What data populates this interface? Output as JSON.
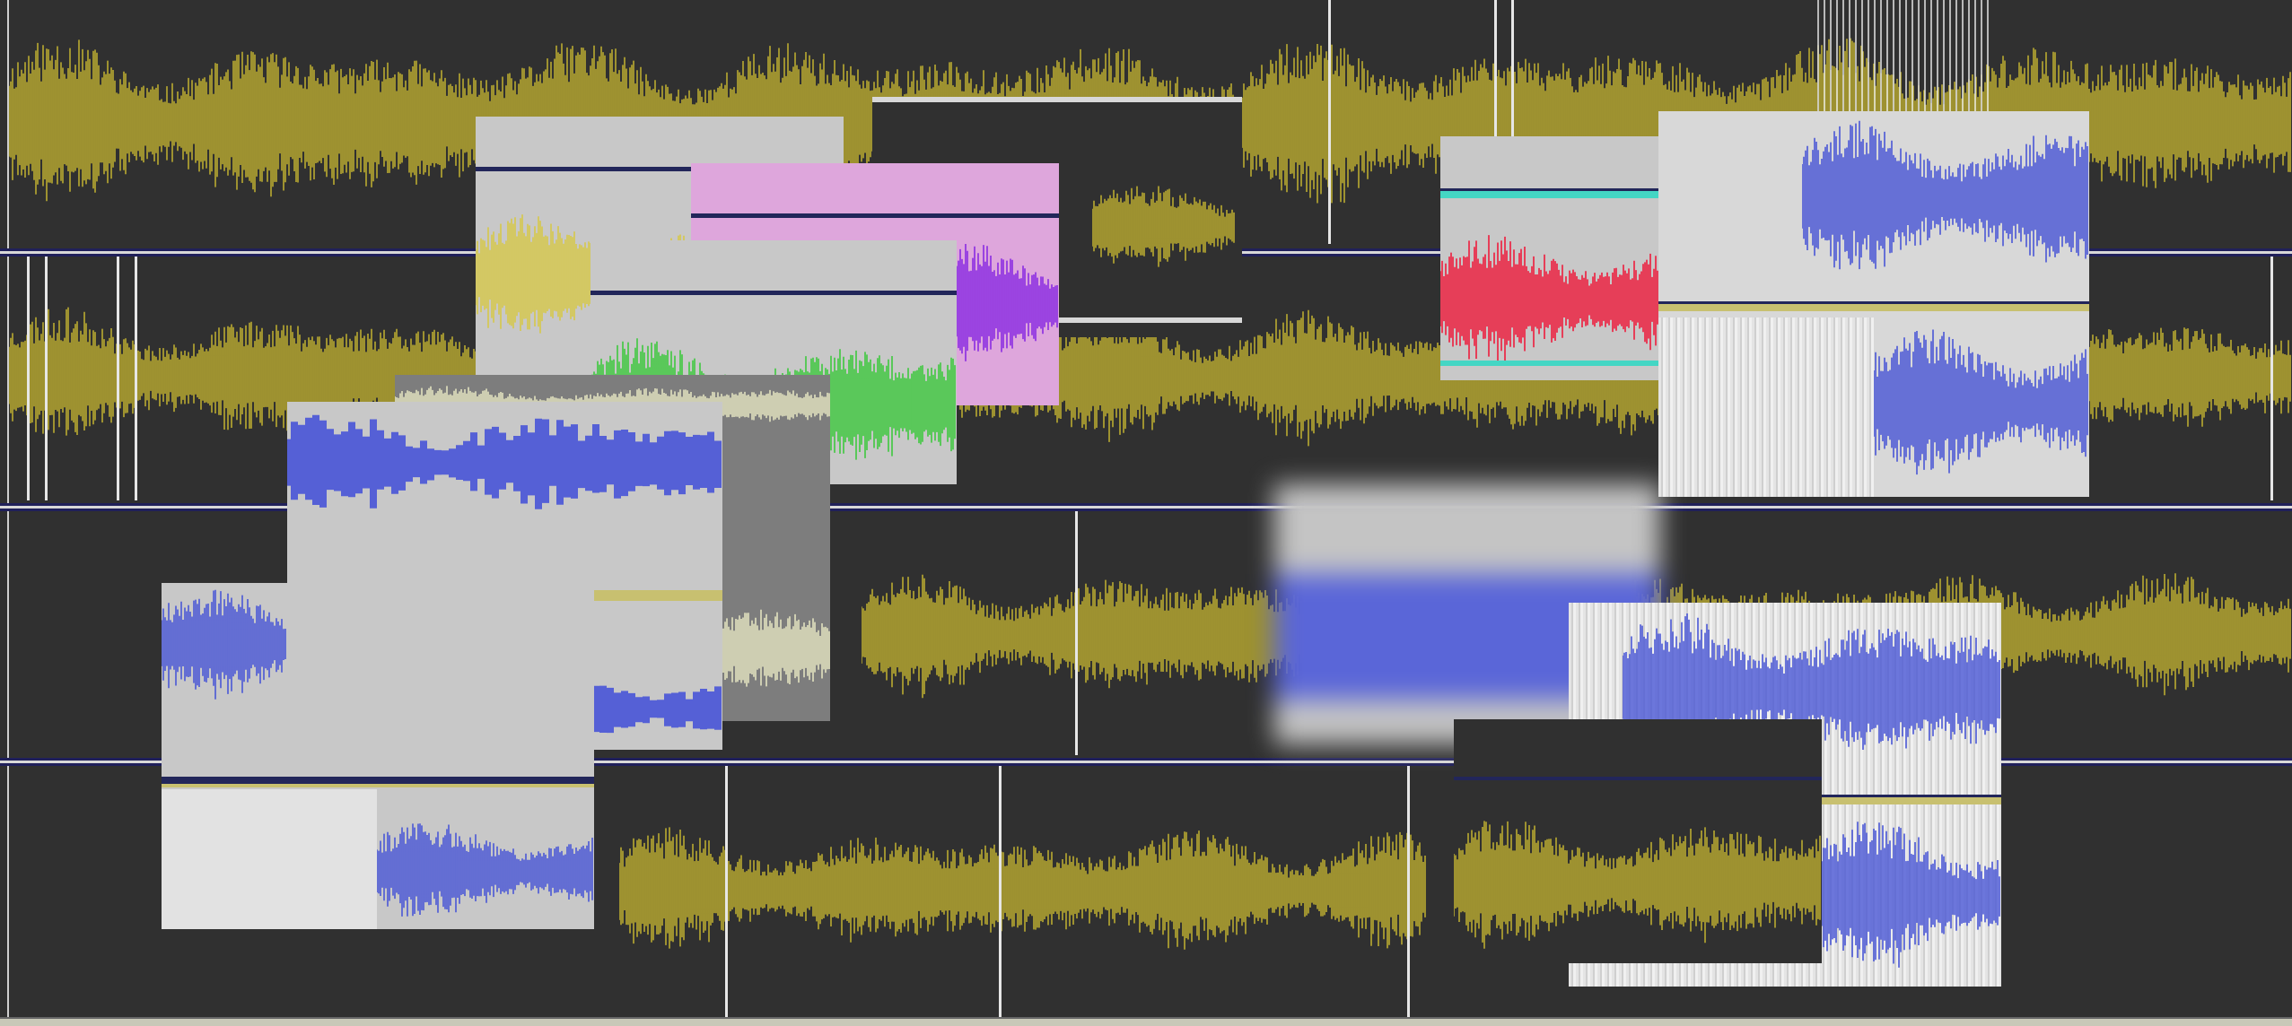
{
  "app": {
    "type": "multitrack-audio-waveform-editor",
    "track_count": 4
  },
  "icons": {
    "overview_clip": "waveform-thumbnail-icon"
  },
  "colors": {
    "background": "#2e2e2e",
    "waveform": "#b9aa30",
    "waveform_dark": "#8a7f1f",
    "separator": "#d8d8d8",
    "separator_edge": "#20205a",
    "clip_pink": "#dea6dc",
    "clip_purple_wave": "#8a2be2",
    "clip_gray": "#c8c8c8",
    "clip_green_wave": "#3ec83e",
    "clip_red_wave": "#ee1c3c",
    "clip_blue_wave": "#4a57d6",
    "teal_bar": "#44d6c4",
    "navy_bar": "#22265a",
    "yellow_bar": "#c8c070"
  }
}
